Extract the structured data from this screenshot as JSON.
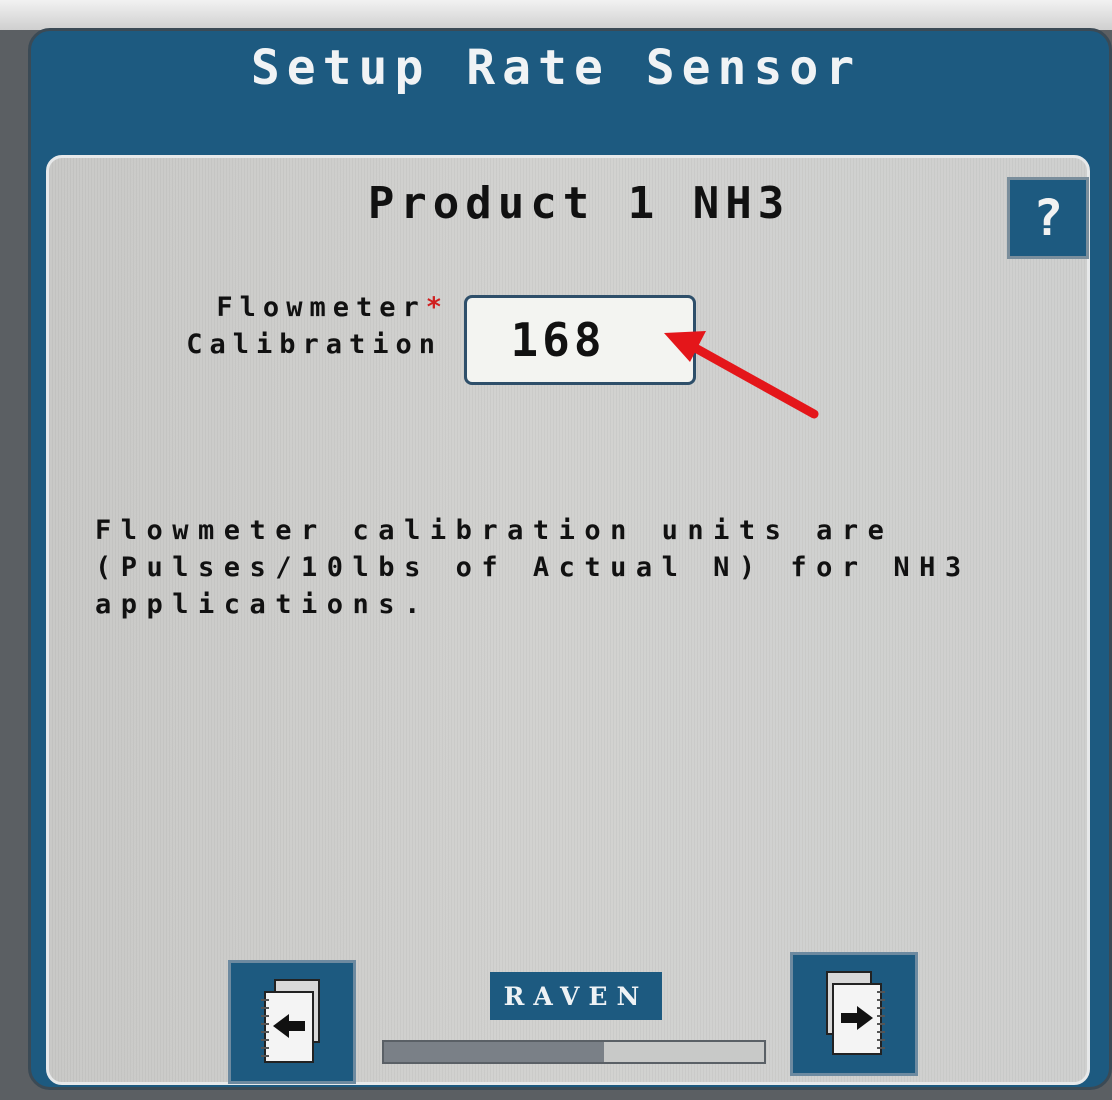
{
  "header": {
    "title": "Setup Rate Sensor"
  },
  "panel": {
    "heading": "Product 1 NH3",
    "help_label": "?",
    "field": {
      "label_line1": "Flowmeter",
      "required_mark": "*",
      "label_line2": "Calibration",
      "value": "168"
    },
    "info_lines": [
      "Flowmeter calibration units are",
      "(Pulses/10lbs of Actual N) for NH3",
      "applications."
    ]
  },
  "footer": {
    "brand": "RAVEN",
    "progress": 0.58,
    "prev_icon": "page-back-icon",
    "next_icon": "page-forward-icon"
  },
  "annotation": {
    "color": "#e4161a"
  },
  "colors": {
    "accent": "#1d5a80",
    "panel": "#cfcfcd",
    "required": "#d02020"
  }
}
